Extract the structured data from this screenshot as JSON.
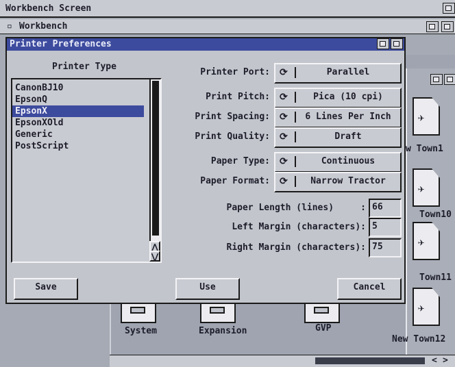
{
  "screen": {
    "title": "Workbench Screen"
  },
  "workbench": {
    "title": "Workbench"
  },
  "desktop_icons": [
    {
      "name": "System"
    },
    {
      "name": "Expansion"
    },
    {
      "name": "GVP"
    }
  ],
  "right_window": {
    "items": [
      "w Town1",
      "Town10",
      "Town11",
      "New Town12"
    ]
  },
  "dialog": {
    "title": "Printer Preferences",
    "printer_type": {
      "heading": "Printer Type",
      "items": [
        "CanonBJ10",
        "EpsonQ",
        "EpsonX",
        "EpsonXOld",
        "Generic",
        "PostScript"
      ],
      "selected": "EpsonX"
    },
    "settings": [
      {
        "label": "Printer Port:",
        "value": "Parallel"
      },
      {
        "label": "Print Pitch:",
        "value": "Pica (10 cpi)"
      },
      {
        "label": "Print Spacing:",
        "value": "6 Lines Per Inch"
      },
      {
        "label": "Print Quality:",
        "value": "Draft"
      },
      {
        "label": "Paper Type:",
        "value": "Continuous"
      },
      {
        "label": "Paper Format:",
        "value": "Narrow Tractor"
      }
    ],
    "numeric": [
      {
        "label": "Paper Length (lines)     :",
        "value": "66"
      },
      {
        "label": "Left Margin (characters):",
        "value": "5"
      },
      {
        "label": "Right Margin (characters):",
        "value": "75"
      }
    ],
    "buttons": {
      "save": "Save",
      "use": "Use",
      "cancel": "Cancel"
    }
  },
  "glyphs": {
    "cycle": "⟳",
    "up": "⋀",
    "down": "⋁",
    "left": "<",
    "right": ">",
    "close": "▫"
  }
}
